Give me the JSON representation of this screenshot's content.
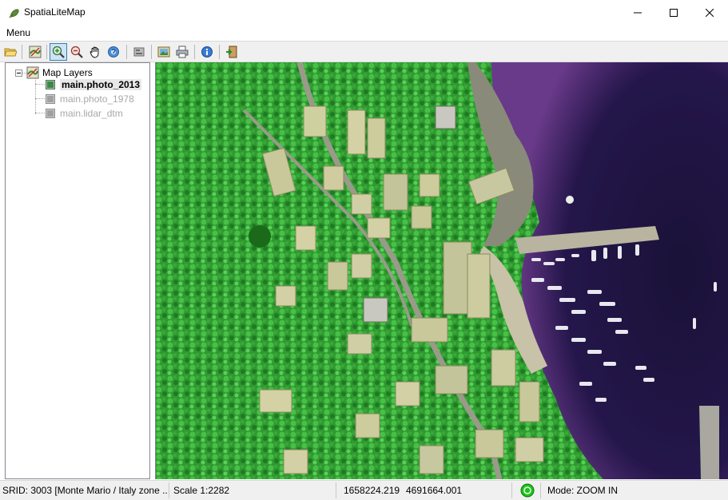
{
  "window": {
    "title": "SpatiaLiteMap",
    "menu_label": "Menu"
  },
  "toolbar": {
    "buttons": [
      {
        "name": "open-folder-icon"
      },
      {
        "name": "layer-properties-icon"
      },
      {
        "name": "zoom-in-icon",
        "active": true
      },
      {
        "name": "zoom-out-icon"
      },
      {
        "name": "pan-hand-icon"
      },
      {
        "name": "identify-icon"
      },
      {
        "name": "settings-icon"
      },
      {
        "name": "export-image-icon"
      },
      {
        "name": "print-icon"
      },
      {
        "name": "about-icon"
      },
      {
        "name": "exit-icon"
      }
    ]
  },
  "layers": {
    "root_label": "Map Layers",
    "items": [
      {
        "label": "main.photo_2013",
        "state": "selected"
      },
      {
        "label": "main.photo_1978",
        "state": "disabled"
      },
      {
        "label": "main.lidar_dtm",
        "state": "disabled"
      }
    ]
  },
  "status": {
    "srid": "SRID: 3003 [Monte Mario / Italy zone ...",
    "scale": "Scale 1:2282",
    "x": "1658224.219",
    "y": "4691664.001",
    "mode": "Mode: ZOOM IN"
  },
  "colors": {
    "vegetation": "#2f9a2f",
    "water": "#2b1a4a",
    "accent_selection": "#cce4f7",
    "status_indicator": "#1fc21f"
  }
}
